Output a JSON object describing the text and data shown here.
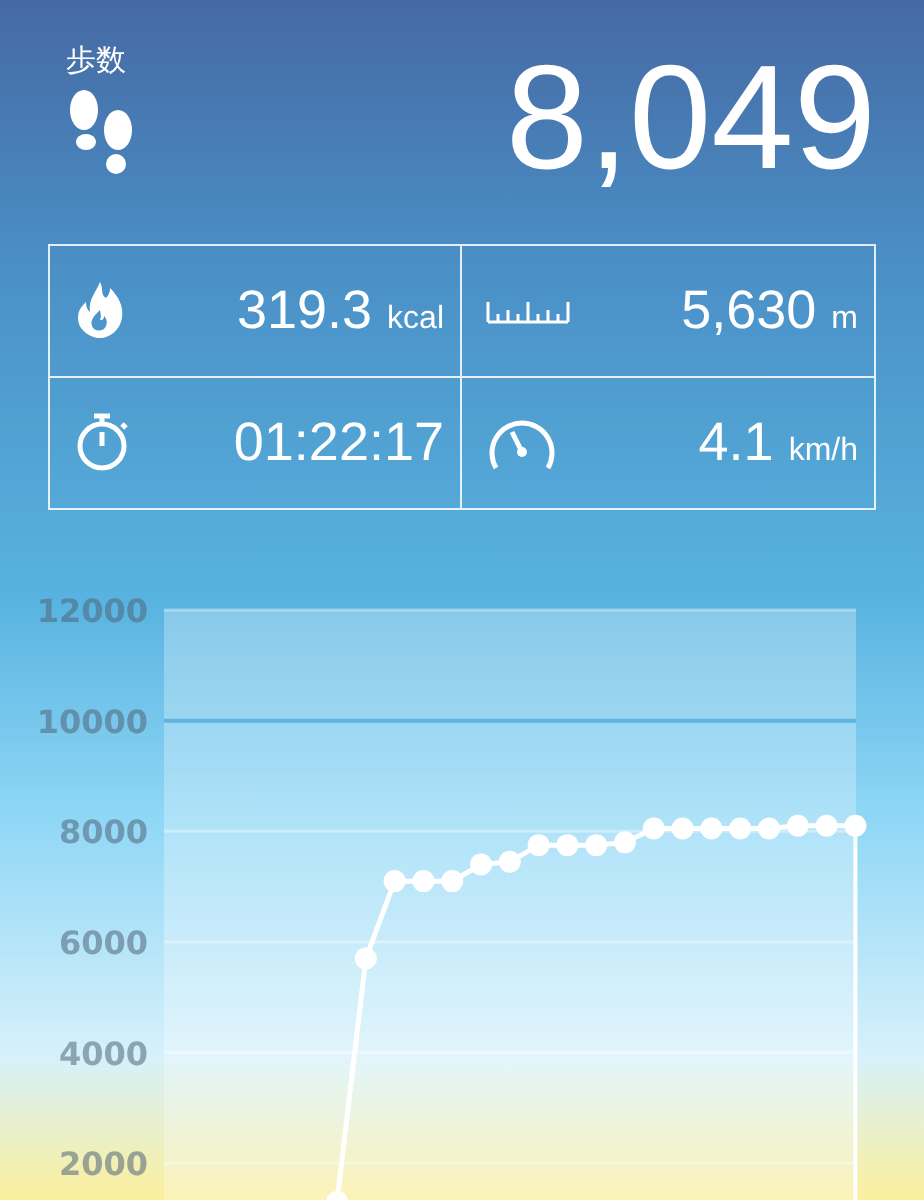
{
  "header": {
    "label": "歩数",
    "steps": "8,049"
  },
  "stats": [
    {
      "kind": "calories",
      "value": "319.3",
      "unit": "kcal"
    },
    {
      "kind": "distance",
      "value": "5,630",
      "unit": "m"
    },
    {
      "kind": "duration",
      "value": "01:22:17"
    },
    {
      "kind": "speed",
      "value": "4.1",
      "unit": "km/h"
    }
  ],
  "chart": {
    "chart_data": {
      "type": "line",
      "ylim": [
        1300,
        12000
      ],
      "grid": true,
      "yticks": [
        2000,
        4000,
        6000,
        8000,
        10000,
        12000
      ],
      "ref_lines": [
        {
          "axis": "y",
          "value": 10000
        }
      ],
      "series": [
        {
          "color": "#ffffff",
          "marker": true,
          "values": [
            1300,
            5700,
            7100,
            7100,
            7100,
            7400,
            7450,
            7750,
            7750,
            7750,
            7800,
            8050,
            8050,
            8050,
            8050,
            8050,
            8100,
            8100,
            8100
          ]
        }
      ]
    }
  }
}
